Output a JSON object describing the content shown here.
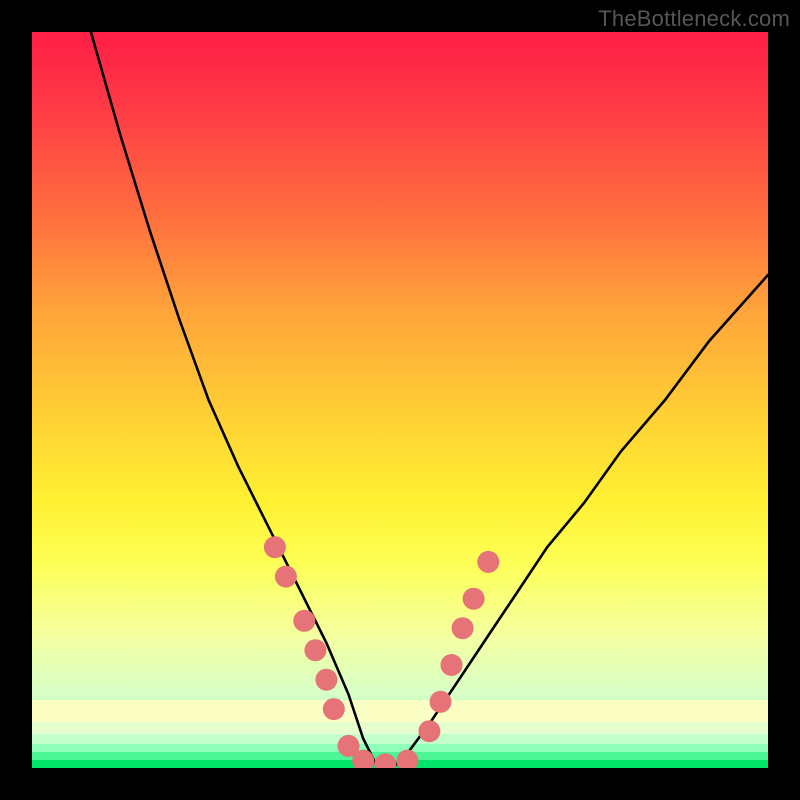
{
  "watermark": "TheBottleneck.com",
  "chart_data": {
    "type": "line",
    "title": "",
    "xlabel": "",
    "ylabel": "",
    "xlim": [
      0,
      100
    ],
    "ylim": [
      0,
      100
    ],
    "grid": false,
    "legend": false,
    "note": "No axes or numeric labels are rendered. Values are estimated proportions of the plot area (0–100). The curve is a V-shaped line reaching its minimum near x≈47 at y≈0, with salmon dots clustered on both flanks of the valley.",
    "series": [
      {
        "name": "curve",
        "color": "#000000",
        "x": [
          8,
          12,
          16,
          20,
          24,
          28,
          32,
          36,
          40,
          43,
          45,
          47,
          49,
          51,
          54,
          58,
          62,
          66,
          70,
          75,
          80,
          86,
          92,
          100
        ],
        "y": [
          100,
          86,
          73,
          61,
          50,
          41,
          33,
          25,
          17,
          10,
          4,
          0,
          0,
          2,
          6,
          12,
          18,
          24,
          30,
          36,
          43,
          50,
          58,
          67
        ]
      }
    ],
    "dots": {
      "name": "markers",
      "color": "#e57377",
      "points": [
        {
          "x": 33,
          "y": 30
        },
        {
          "x": 34.5,
          "y": 26
        },
        {
          "x": 37,
          "y": 20
        },
        {
          "x": 38.5,
          "y": 16
        },
        {
          "x": 40,
          "y": 12
        },
        {
          "x": 41,
          "y": 8
        },
        {
          "x": 43,
          "y": 3
        },
        {
          "x": 45,
          "y": 1
        },
        {
          "x": 48,
          "y": 0.5
        },
        {
          "x": 51,
          "y": 1
        },
        {
          "x": 54,
          "y": 5
        },
        {
          "x": 55.5,
          "y": 9
        },
        {
          "x": 57,
          "y": 14
        },
        {
          "x": 58.5,
          "y": 19
        },
        {
          "x": 60,
          "y": 23
        },
        {
          "x": 62,
          "y": 28
        }
      ]
    },
    "background_gradient": {
      "top": "#ff1e46",
      "bottom": "#00e56a"
    }
  }
}
